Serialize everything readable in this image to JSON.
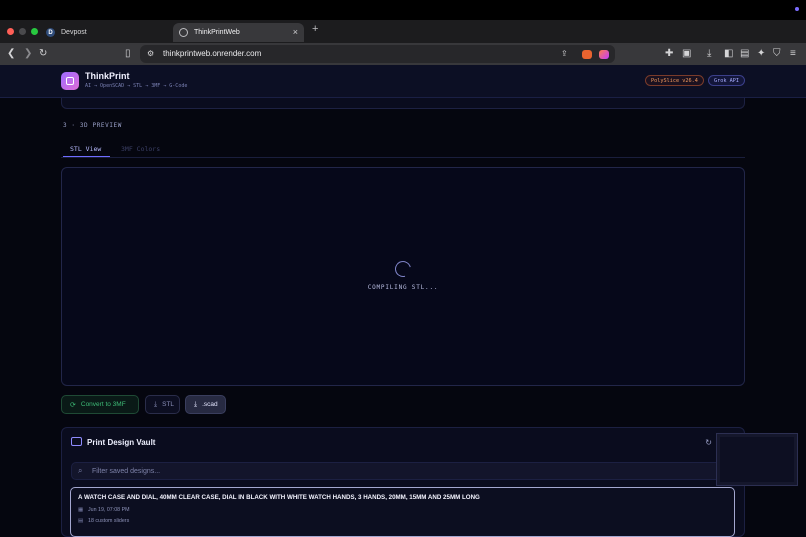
{
  "browser": {
    "tabs": [
      {
        "label": "Devpost",
        "favicon": "D"
      },
      {
        "label": "ThinkPrintWeb"
      }
    ],
    "url": "thinkprintweb.onrender.com",
    "newtab": "+",
    "close": "×"
  },
  "app": {
    "name": "ThinkPrint",
    "subtitle": "AI → OpenSCAD → STL → 3MF → G-Code",
    "badges": [
      "PolySlice v26.4",
      "Grok API"
    ]
  },
  "preview": {
    "section_title": "3 · 3D PREVIEW",
    "tabs": [
      "STL View",
      "3MF Colors"
    ],
    "status": "COMPILING STL..."
  },
  "actions": {
    "convert": "Convert to 3MF",
    "stl": "STL",
    "scad": ".scad"
  },
  "vault": {
    "title": "Print Design Vault",
    "filter_placeholder": "Filter saved designs...",
    "designs": [
      {
        "title": "A WATCH CASE AND DIAL, 40MM CLEAR CASE, DIAL IN BLACK WITH WHITE WATCH HANDS, 3 HANDS, 20MM, 15MM AND 25MM LONG",
        "date": "Jun 19, 07:08 PM",
        "sliders": "18 custom sliders"
      }
    ]
  },
  "colors": {
    "accent": "#6f6cff",
    "success": "#3dbb76",
    "warning": "#f09a5e"
  }
}
